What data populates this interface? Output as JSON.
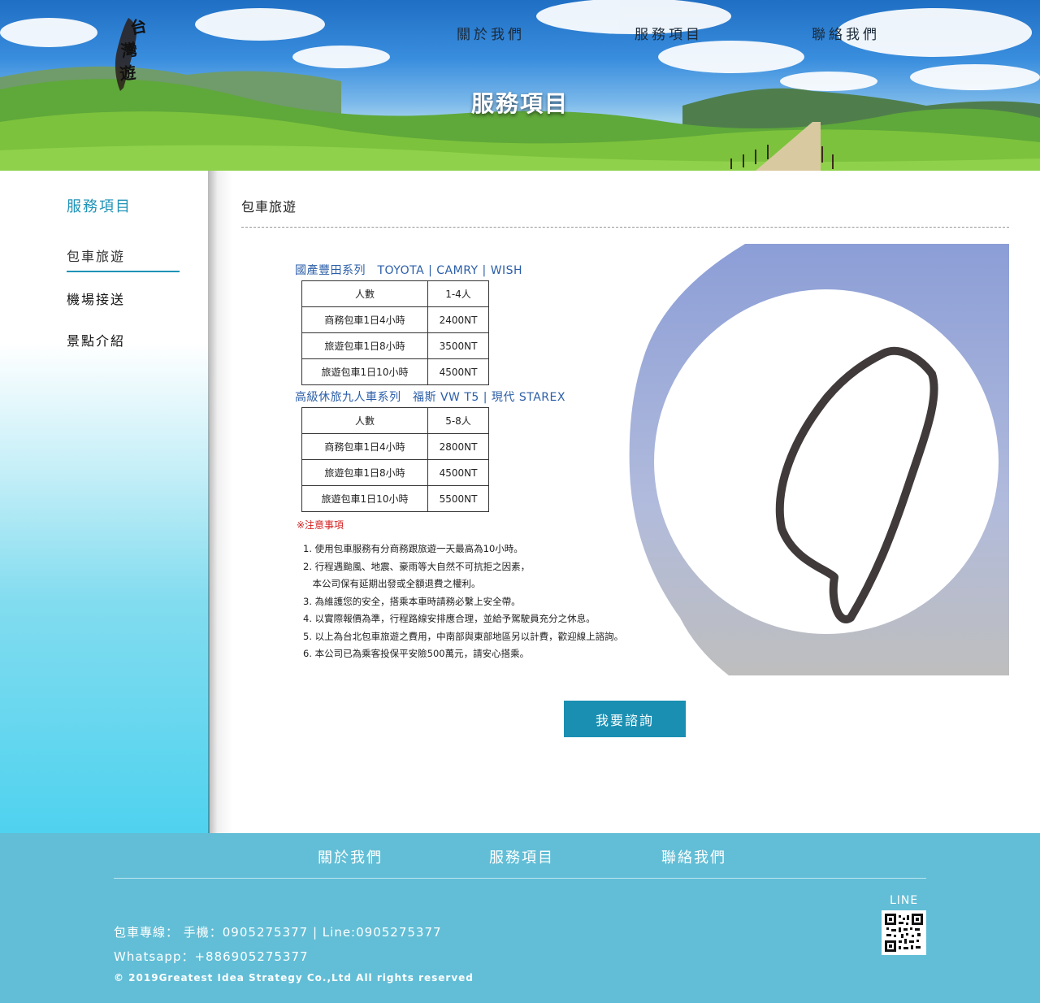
{
  "header": {
    "logo_text": "台灣遊",
    "nav": [
      "關於我們",
      "服務項目",
      "聯絡我們"
    ],
    "banner_title": "服務項目"
  },
  "sidebar": {
    "title": "服務項目",
    "items": [
      {
        "label": "包車旅遊",
        "active": true
      },
      {
        "label": "機場接送",
        "active": false
      },
      {
        "label": "景點介紹",
        "active": false
      }
    ]
  },
  "main": {
    "title": "包車旅遊",
    "promo": {
      "series1": {
        "title": "國產豐田系列　TOYOTA | CAMRY | WISH",
        "rows": [
          [
            "人數",
            "1-4人"
          ],
          [
            "商務包車1日4小時",
            "2400NT"
          ],
          [
            "旅遊包車1日8小時",
            "3500NT"
          ],
          [
            "旅遊包車1日10小時",
            "4500NT"
          ]
        ]
      },
      "series2": {
        "title": "高級休旅九人車系列　福斯 VW T5 | 現代 STAREX",
        "rows": [
          [
            "人數",
            "5-8人"
          ],
          [
            "商務包車1日4小時",
            "2800NT"
          ],
          [
            "旅遊包車1日8小時",
            "4500NT"
          ],
          [
            "旅遊包車1日10小時",
            "5500NT"
          ]
        ]
      },
      "notes_heading": "※注意事項",
      "notes": [
        "1. 使用包車服務有分商務跟旅遊一天最高為10小時。",
        "2. 行程遇颱風、地震、豪雨等大自然不可抗拒之因素，",
        "　本公司保有延期出發或全額退費之權利。",
        "3. 為維護您的安全，搭乘本車時請務必繫上安全帶。",
        "4. 以實際報價為準，行程路線安排應合理，並給予駕駛員充分之休息。",
        "5. 以上為台北包車旅遊之費用，中南部與東部地區另以計費，歡迎線上諮詢。",
        "6. 本公司已為乘客投保平安險500萬元，請安心搭乘。"
      ]
    },
    "cta_label": "我要諮詢"
  },
  "footer": {
    "nav": [
      "關於我們",
      "服務項目",
      "聯絡我們"
    ],
    "contact_line": "包車專線： 手機：0905275377 | Line:0905275377",
    "whatsapp": "Whatsapp：+886905275377",
    "copyright": "© 2019Greatest Idea Strategy Co.,Ltd All rights reserved",
    "line_label": "LINE"
  },
  "colors": {
    "accent": "#1e93b7",
    "cta_bg": "#1a8fb2",
    "footer_bg": "#62bed6",
    "notes_red": "#d42020",
    "series_blue": "#2b5ea8"
  }
}
